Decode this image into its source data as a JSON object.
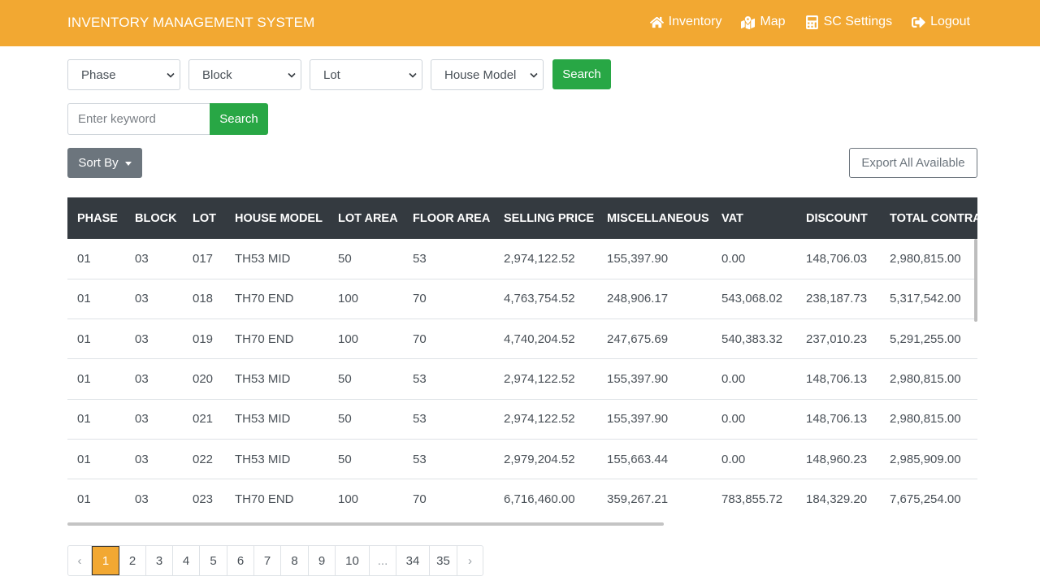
{
  "navbar": {
    "brand": "INVENTORY MANAGEMENT SYSTEM",
    "items": [
      {
        "label": "Inventory",
        "icon": "home-icon"
      },
      {
        "label": "Map",
        "icon": "map-icon"
      },
      {
        "label": "SC Settings",
        "icon": "calculator-icon"
      },
      {
        "label": "Logout",
        "icon": "sign-out-icon"
      }
    ]
  },
  "filters": {
    "phase": "Phase",
    "block": "Block",
    "lot": "Lot",
    "house_model": "House Model",
    "search_label": "Search",
    "keyword_placeholder": "Enter keyword",
    "keyword_search_label": "Search"
  },
  "toolbar": {
    "sort_label": "Sort By",
    "export_label": "Export All Available"
  },
  "table": {
    "headers": [
      "PHASE",
      "BLOCK",
      "LOT",
      "HOUSE MODEL",
      "LOT AREA",
      "FLOOR AREA",
      "SELLING PRICE",
      "MISCELLANEOUS",
      "VAT",
      "DISCOUNT",
      "TOTAL CONTRACT"
    ],
    "rows": [
      [
        "01",
        "03",
        "017",
        "TH53 MID",
        "50",
        "53",
        "2,974,122.52",
        "155,397.90",
        "0.00",
        "148,706.03",
        "2,980,815.00"
      ],
      [
        "01",
        "03",
        "018",
        "TH70 END",
        "100",
        "70",
        "4,763,754.52",
        "248,906.17",
        "543,068.02",
        "238,187.73",
        "5,317,542.00"
      ],
      [
        "01",
        "03",
        "019",
        "TH70 END",
        "100",
        "70",
        "4,740,204.52",
        "247,675.69",
        "540,383.32",
        "237,010.23",
        "5,291,255.00"
      ],
      [
        "01",
        "03",
        "020",
        "TH53 MID",
        "50",
        "53",
        "2,974,122.52",
        "155,397.90",
        "0.00",
        "148,706.13",
        "2,980,815.00"
      ],
      [
        "01",
        "03",
        "021",
        "TH53 MID",
        "50",
        "53",
        "2,974,122.52",
        "155,397.90",
        "0.00",
        "148,706.13",
        "2,980,815.00"
      ],
      [
        "01",
        "03",
        "022",
        "TH53 MID",
        "50",
        "53",
        "2,979,204.52",
        "155,663.44",
        "0.00",
        "148,960.23",
        "2,985,909.00"
      ],
      [
        "01",
        "03",
        "023",
        "TH70 END",
        "100",
        "70",
        "6,716,460.00",
        "359,267.21",
        "783,855.72",
        "184,329.20",
        "7,675,254.00"
      ]
    ]
  },
  "pagination": {
    "prev": "‹",
    "pages": [
      "1",
      "2",
      "3",
      "4",
      "5",
      "6",
      "7",
      "8",
      "9",
      "10",
      "...",
      "34",
      "35"
    ],
    "active": "1",
    "next": "›"
  },
  "colors": {
    "brand": "#f2a832",
    "search_button": "#28a745",
    "table_header": "#343a40",
    "sort_button": "#6c757d"
  }
}
